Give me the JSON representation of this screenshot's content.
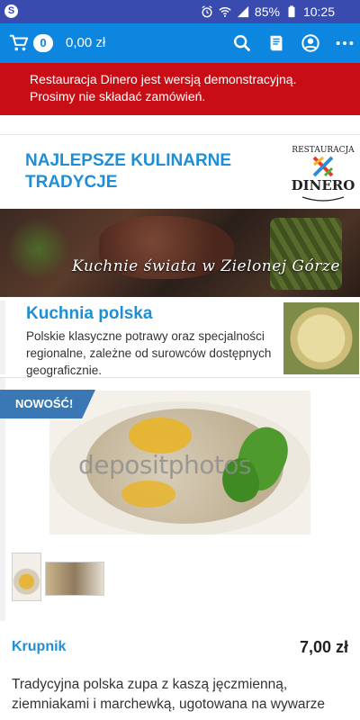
{
  "status_bar": {
    "app_icon": "skype-icon",
    "icons": [
      "alarm-icon",
      "wifi-icon",
      "signal-icon"
    ],
    "battery": "85%",
    "time": "10:25"
  },
  "app_bar": {
    "cart_count": "0",
    "cart_total": "0,00 zł",
    "icons": [
      "search-icon",
      "menu-book-icon",
      "account-icon",
      "more-icon"
    ],
    "color": "#0d86e0"
  },
  "demo_banner": {
    "line1": "Restauracja Dinero jest wersją demonstracyjną.",
    "line2": "Prosimy nie składać zamówień.",
    "color": "#c80d14"
  },
  "header": {
    "tagline": "NAJLEPSZE KULINARNE TRADYCJE",
    "logo_top": "RESTAURACJA",
    "logo_name": "DINERO"
  },
  "hero": {
    "script_text": "Kuchnie świata w Zielonej Górze"
  },
  "category": {
    "title": "Kuchnia polska",
    "description": "Polskie klasyczne potrawy oraz specjalności regionalne, zależne od surowców dostępnych geograficznie."
  },
  "product": {
    "badge": "NOWOŚĆ!",
    "watermark": "depositphotos",
    "name": "Krupnik",
    "price": "7,00 zł",
    "description": "Tradycyjna polska zupa z kaszą jęczmienną, ziemniakami i marchewką, ugotowana na wywarze"
  }
}
